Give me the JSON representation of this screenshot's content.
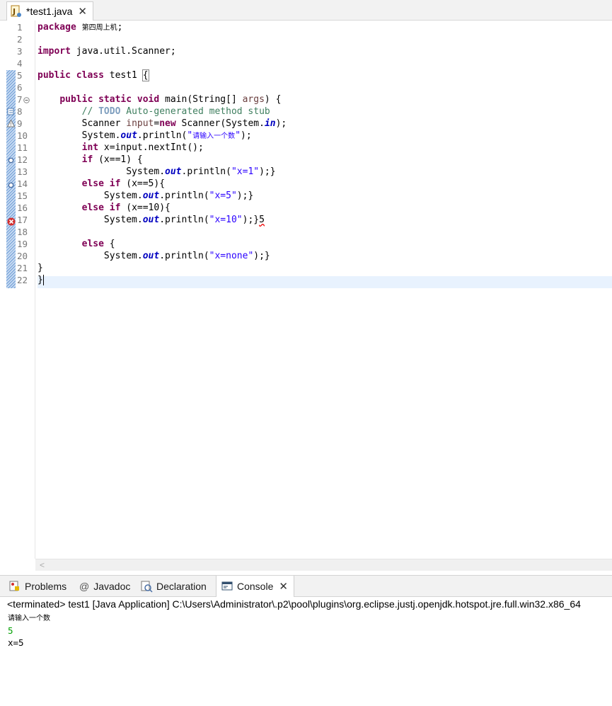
{
  "editor_tab": {
    "title": "*test1.java",
    "close": "✕"
  },
  "lines": {
    "n1": "1",
    "n2": "2",
    "n3": "3",
    "n4": "4",
    "n5": "5",
    "n6": "6",
    "n7": "7",
    "n8": "8",
    "n9": "9",
    "n10": "10",
    "n11": "11",
    "n12": "12",
    "n13": "13",
    "n14": "14",
    "n15": "15",
    "n16": "16",
    "n17": "17",
    "n18": "18",
    "n19": "19",
    "n20": "20",
    "n21": "21",
    "n22": "22"
  },
  "code": {
    "l1_kw": "package",
    "l1_pkg": "第四周上机",
    "l1_semi": ";",
    "l3_kw": "import",
    "l3_rest": " java.util.Scanner;",
    "l5_kw": "public class",
    "l5_name": " test1 ",
    "l5_brace": "{",
    "l7_kw": "public static void",
    "l7_rest": " main(String[] ",
    "l7_args": "args",
    "l7_end": ") {",
    "l8_cm": "// ",
    "l8_todo": "TODO",
    "l8_rest": " Auto-generated method stub",
    "l9_a": "Scanner ",
    "l9_var": "input",
    "l9_b": "=",
    "l9_kw": "new",
    "l9_c": " Scanner(System.",
    "l9_in": "in",
    "l9_d": ");",
    "l10_a": "System.",
    "l10_out": "out",
    "l10_b": ".println(",
    "l10_q1": "\"",
    "l10_str": "请输入一个数",
    "l10_q2": "\"",
    "l10_c": ");",
    "l11_kw": "int",
    "l11_rest": " x=input.nextInt();",
    "l12_kw": "if",
    "l12_rest": " (x==1) {",
    "l13_a": "System.",
    "l13_out": "out",
    "l13_b": ".println(",
    "l13_str": "\"x=1\"",
    "l13_c": ");}",
    "l14_kw": "else if",
    "l14_rest": " (x==5){",
    "l15_a": "System.",
    "l15_out": "out",
    "l15_b": ".println(",
    "l15_str": "\"x=5\"",
    "l15_c": ");}",
    "l16_kw": "else if",
    "l16_rest": " (x==10){",
    "l17_a": "System.",
    "l17_out": "out",
    "l17_b": ".println(",
    "l17_str": "\"x=10\"",
    "l17_c": ");}",
    "l17_err": "5",
    "l19_kw": "else",
    "l19_rest": " {",
    "l20_a": "System.",
    "l20_out": "out",
    "l20_b": ".println(",
    "l20_str": "\"x=none\"",
    "l20_c": ");}",
    "l21": "}",
    "l22": "}"
  },
  "panel_tabs": {
    "problems": "Problems",
    "javadoc_icon": "@",
    "javadoc": "Javadoc",
    "declaration": "Declaration",
    "console": "Console",
    "console_close": "✕"
  },
  "console": {
    "header": "<terminated> test1 [Java Application] C:\\Users\\Administrator\\.p2\\pool\\plugins\\org.eclipse.justj.openjdk.hotspot.jre.full.win32.x86_64",
    "lines": [
      "请输入一个数",
      "5",
      "x=5"
    ]
  },
  "colors": {
    "keyword": "#7f0055",
    "comment": "#3f7f5f",
    "string": "#2a00ff",
    "field": "#0000c0",
    "current_line": "#e8f2fe",
    "stdin": "#00a000",
    "error": "#e00000"
  }
}
